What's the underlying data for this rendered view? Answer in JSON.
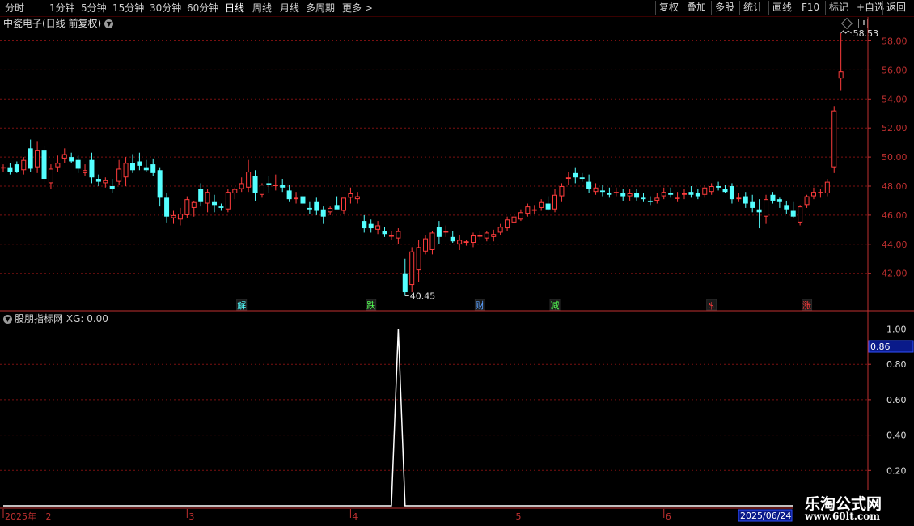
{
  "toolbar": {
    "tabs": [
      "分时",
      "1分钟",
      "5分钟",
      "15分钟",
      "30分钟",
      "60分钟",
      "日线",
      "周线",
      "月线",
      "多周期",
      "更多"
    ],
    "active_tab": "日线",
    "right_buttons": [
      "复权",
      "叠加",
      "多股",
      "统计",
      "画线",
      "F10",
      "标记",
      "+自选",
      "返回"
    ]
  },
  "stock": {
    "title": "中瓷电子(日线 前复权)"
  },
  "indicator": {
    "title": "股朋指标网",
    "value_text": "XG: 0.00",
    "current_value": "0.86"
  },
  "colors": {
    "up": "#ff3c3c",
    "down": "#54ffff",
    "grid": "#7a1010",
    "axis": "#c03030",
    "line": "#ffffff"
  },
  "chart_data": [
    {
      "type": "candlestick",
      "y_ticks": [
        "58.00",
        "56.00",
        "54.00",
        "52.00",
        "50.00",
        "48.00",
        "46.00",
        "44.00",
        "42.00"
      ],
      "ylim": [
        40.0,
        59.0
      ],
      "max_label": "58.53",
      "min_label": "40.45",
      "event_markers": [
        {
          "index": 35,
          "label": "解",
          "color": "#54ffff"
        },
        {
          "index": 54,
          "label": "跌",
          "color": "#54ff54"
        },
        {
          "index": 70,
          "label": "财",
          "color": "#5aa0ff"
        },
        {
          "index": 81,
          "label": "减",
          "color": "#54ff54"
        },
        {
          "index": 104,
          "label": "$",
          "color": "#ff3c3c"
        },
        {
          "index": 118,
          "label": "涨",
          "color": "#ff3c3c"
        }
      ],
      "candles": [
        [
          49.3,
          49.5,
          49.0,
          49.3
        ],
        [
          49.3,
          49.6,
          48.8,
          49.0
        ],
        [
          49.5,
          49.7,
          48.9,
          49.0
        ],
        [
          49.1,
          50.0,
          48.8,
          49.8
        ],
        [
          50.6,
          51.2,
          49.0,
          49.2
        ],
        [
          49.3,
          51.1,
          48.9,
          50.5
        ],
        [
          50.5,
          50.8,
          48.2,
          48.5
        ],
        [
          48.2,
          49.5,
          47.8,
          49.2
        ],
        [
          49.3,
          50.1,
          49.0,
          49.6
        ],
        [
          49.9,
          50.6,
          49.6,
          50.2
        ],
        [
          50.0,
          50.3,
          49.6,
          49.7
        ],
        [
          49.8,
          50.1,
          48.9,
          49.2
        ],
        [
          48.9,
          49.5,
          48.7,
          49.1
        ],
        [
          49.8,
          50.3,
          48.2,
          48.6
        ],
        [
          48.5,
          48.8,
          48.0,
          48.3
        ],
        [
          48.2,
          48.6,
          47.9,
          48.4
        ],
        [
          48.0,
          48.5,
          47.5,
          47.8
        ],
        [
          48.3,
          49.8,
          48.1,
          49.2
        ],
        [
          48.6,
          50.0,
          48.0,
          49.6
        ],
        [
          49.6,
          50.2,
          48.9,
          49.1
        ],
        [
          49.7,
          50.3,
          49.1,
          49.4
        ],
        [
          49.3,
          49.8,
          49.0,
          49.1
        ],
        [
          49.5,
          49.9,
          48.7,
          48.9
        ],
        [
          49.1,
          49.3,
          46.6,
          47.2
        ],
        [
          47.2,
          47.5,
          45.5,
          45.9
        ],
        [
          45.8,
          46.3,
          45.4,
          46.0
        ],
        [
          45.7,
          46.5,
          45.3,
          46.1
        ],
        [
          46.0,
          47.3,
          45.8,
          47.1
        ],
        [
          46.5,
          47.0,
          45.9,
          46.9
        ],
        [
          47.8,
          48.2,
          46.6,
          46.9
        ],
        [
          46.8,
          47.8,
          46.2,
          47.6
        ],
        [
          46.9,
          47.4,
          46.2,
          46.7
        ],
        [
          46.6,
          46.8,
          46.3,
          46.5
        ],
        [
          46.4,
          47.8,
          46.2,
          47.6
        ],
        [
          47.5,
          47.9,
          47.1,
          47.8
        ],
        [
          47.8,
          48.6,
          47.6,
          48.2
        ],
        [
          47.9,
          49.8,
          47.6,
          49.0
        ],
        [
          48.7,
          49.1,
          47.0,
          47.5
        ],
        [
          47.4,
          48.2,
          47.2,
          48.1
        ],
        [
          48.2,
          48.7,
          47.5,
          48.1
        ],
        [
          48.0,
          48.8,
          47.7,
          48.1
        ],
        [
          48.1,
          48.5,
          47.6,
          47.9
        ],
        [
          47.7,
          48.1,
          46.9,
          47.1
        ],
        [
          47.1,
          47.6,
          46.8,
          47.2
        ],
        [
          47.3,
          47.5,
          46.6,
          46.8
        ],
        [
          46.5,
          46.9,
          46.1,
          46.4
        ],
        [
          46.9,
          47.2,
          46.0,
          46.3
        ],
        [
          46.4,
          46.6,
          45.4,
          45.9
        ],
        [
          46.2,
          46.6,
          46.0,
          46.5
        ],
        [
          46.7,
          47.3,
          46.5,
          46.4
        ],
        [
          46.3,
          47.1,
          46.1,
          47.2
        ],
        [
          47.2,
          47.9,
          46.8,
          47.5
        ],
        [
          47.1,
          47.6,
          46.8,
          47.3
        ],
        [
          45.6,
          46.0,
          44.8,
          45.1
        ],
        [
          45.4,
          45.7,
          44.8,
          45.1
        ],
        [
          45.0,
          45.6,
          44.7,
          45.3
        ],
        [
          44.9,
          45.2,
          44.5,
          44.7
        ],
        [
          44.6,
          44.9,
          44.3,
          44.6
        ],
        [
          44.4,
          45.1,
          44.0,
          44.9
        ],
        [
          42.0,
          43.0,
          40.45,
          40.7
        ],
        [
          41.2,
          43.8,
          40.7,
          43.5
        ],
        [
          42.2,
          44.3,
          41.4,
          43.8
        ],
        [
          43.5,
          44.6,
          43.3,
          44.4
        ],
        [
          43.6,
          44.9,
          43.3,
          44.8
        ],
        [
          45.2,
          45.6,
          44.0,
          44.5
        ],
        [
          44.8,
          45.3,
          44.5,
          44.9
        ],
        [
          44.5,
          44.9,
          44.1,
          44.2
        ],
        [
          44.0,
          44.6,
          43.6,
          44.3
        ],
        [
          44.1,
          44.3,
          43.9,
          44.2
        ],
        [
          44.1,
          44.8,
          43.8,
          44.6
        ],
        [
          44.6,
          44.9,
          44.3,
          44.6
        ],
        [
          44.4,
          44.9,
          44.2,
          44.8
        ],
        [
          44.5,
          45.0,
          44.2,
          44.7
        ],
        [
          44.8,
          45.4,
          44.6,
          45.2
        ],
        [
          45.1,
          45.9,
          44.9,
          45.7
        ],
        [
          45.5,
          46.1,
          45.3,
          45.9
        ],
        [
          45.7,
          46.4,
          45.6,
          46.2
        ],
        [
          46.1,
          46.8,
          45.9,
          46.6
        ],
        [
          46.3,
          46.7,
          46.1,
          46.4
        ],
        [
          46.5,
          47.1,
          46.3,
          46.9
        ],
        [
          46.8,
          47.3,
          46.3,
          46.4
        ],
        [
          46.4,
          47.8,
          46.2,
          47.4
        ],
        [
          47.3,
          48.2,
          46.9,
          48.0
        ],
        [
          48.5,
          49.0,
          48.1,
          48.6
        ],
        [
          48.9,
          49.3,
          48.2,
          48.6
        ],
        [
          48.6,
          48.9,
          48.3,
          48.5
        ],
        [
          48.3,
          48.8,
          47.5,
          47.8
        ],
        [
          47.6,
          48.2,
          47.4,
          47.9
        ],
        [
          47.7,
          48.1,
          47.3,
          47.6
        ],
        [
          47.5,
          47.9,
          47.2,
          47.4
        ],
        [
          47.6,
          47.9,
          47.3,
          47.6
        ],
        [
          47.5,
          47.8,
          47.0,
          47.3
        ],
        [
          47.3,
          47.8,
          47.0,
          47.5
        ],
        [
          47.5,
          47.8,
          47.0,
          47.2
        ],
        [
          47.2,
          47.5,
          46.9,
          47.1
        ],
        [
          47.0,
          47.3,
          46.7,
          46.9
        ],
        [
          47.0,
          47.5,
          46.8,
          47.2
        ],
        [
          47.3,
          47.9,
          47.1,
          47.6
        ],
        [
          47.5,
          47.9,
          47.2,
          47.4
        ],
        [
          47.2,
          47.6,
          46.9,
          47.2
        ],
        [
          47.4,
          47.8,
          47.1,
          47.5
        ],
        [
          47.6,
          48.0,
          47.2,
          47.4
        ],
        [
          47.5,
          47.8,
          47.1,
          47.3
        ],
        [
          47.4,
          48.1,
          47.2,
          47.9
        ],
        [
          47.6,
          48.2,
          47.4,
          48.0
        ],
        [
          48.0,
          48.3,
          47.7,
          47.9
        ],
        [
          47.8,
          48.1,
          47.5,
          47.6
        ],
        [
          48.0,
          48.2,
          46.8,
          47.1
        ],
        [
          47.1,
          47.5,
          46.9,
          47.2
        ],
        [
          47.3,
          47.6,
          46.5,
          46.8
        ],
        [
          46.9,
          47.4,
          46.2,
          46.5
        ],
        [
          46.4,
          47.1,
          45.1,
          46.2
        ],
        [
          45.9,
          47.4,
          45.4,
          47.1
        ],
        [
          47.4,
          47.6,
          46.8,
          47.0
        ],
        [
          47.1,
          47.2,
          46.5,
          46.9
        ],
        [
          46.7,
          47.0,
          46.1,
          46.4
        ],
        [
          46.3,
          46.9,
          45.8,
          45.9
        ],
        [
          45.5,
          46.7,
          45.3,
          46.6
        ],
        [
          46.7,
          47.4,
          46.5,
          47.3
        ],
        [
          47.3,
          47.9,
          47.1,
          47.6
        ],
        [
          47.5,
          47.8,
          47.2,
          47.6
        ],
        [
          47.5,
          48.5,
          47.3,
          48.3
        ],
        [
          49.3,
          53.5,
          48.9,
          53.2
        ],
        [
          55.4,
          58.53,
          54.6,
          55.9
        ]
      ]
    },
    {
      "type": "line",
      "series": [
        {
          "name": "XG",
          "values": [
            0,
            0,
            0,
            0,
            0,
            0,
            0,
            0,
            0,
            0,
            0,
            0,
            0,
            0,
            0,
            0,
            0,
            0,
            0,
            0,
            0,
            0,
            0,
            0,
            0,
            0,
            0,
            0,
            0,
            0,
            0,
            0,
            0,
            0,
            0,
            0,
            0,
            0,
            0,
            0,
            0,
            0,
            0,
            0,
            0,
            0,
            0,
            0,
            0,
            0,
            0,
            0,
            0,
            0,
            0,
            0,
            0,
            0,
            1,
            0,
            0,
            0,
            0,
            0,
            0,
            0,
            0,
            0,
            0,
            0,
            0,
            0,
            0,
            0,
            0,
            0,
            0,
            0,
            0,
            0,
            0,
            0,
            0,
            0,
            0,
            0,
            0,
            0,
            0,
            0,
            0,
            0,
            0,
            0,
            0,
            0,
            0,
            0,
            0,
            0,
            0,
            0,
            0,
            0,
            0,
            0,
            0,
            0,
            0,
            0,
            0,
            0,
            0,
            0,
            0,
            0,
            0,
            0,
            0,
            0,
            0,
            0,
            0,
            0,
            0,
            0,
            0,
            0,
            0,
            0,
            0,
            0,
            0,
            0,
            0,
            0,
            0,
            0,
            0,
            0
          ]
        }
      ],
      "y_ticks": [
        "1.00",
        "0.80",
        "0.60",
        "0.40",
        "0.20"
      ],
      "ylim": [
        0.0,
        1.1
      ]
    }
  ],
  "x_axis": {
    "labels": [
      {
        "index": 0,
        "text": "2025年"
      },
      {
        "index": 6,
        "text": "2"
      },
      {
        "index": 27,
        "text": "3"
      },
      {
        "index": 51,
        "text": "4"
      },
      {
        "index": 75,
        "text": "5"
      },
      {
        "index": 97,
        "text": "6"
      }
    ],
    "current_date": "2025/06/24"
  },
  "logo": {
    "name": "乐淘公式网",
    "url": "www.60lt.com"
  }
}
